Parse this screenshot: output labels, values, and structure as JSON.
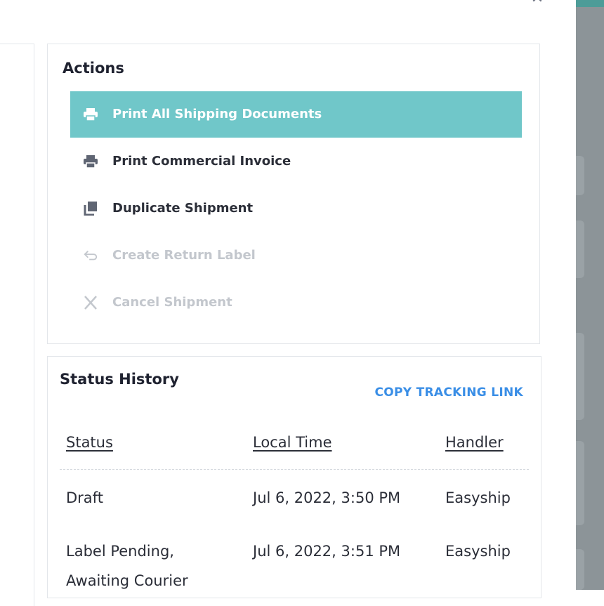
{
  "actions": {
    "title": "Actions",
    "items": [
      {
        "label": "Print All Shipping Documents",
        "icon": "printer-icon",
        "state": "highlighted"
      },
      {
        "label": "Print Commercial Invoice",
        "icon": "printer-icon",
        "state": "enabled"
      },
      {
        "label": "Duplicate Shipment",
        "icon": "duplicate-icon",
        "state": "enabled"
      },
      {
        "label": "Create Return Label",
        "icon": "return-arrow-icon",
        "state": "disabled"
      },
      {
        "label": "Cancel Shipment",
        "icon": "close-icon",
        "state": "disabled"
      }
    ]
  },
  "status_history": {
    "title": "Status History",
    "copy_link_label": "COPY TRACKING LINK",
    "columns": [
      "Status",
      "Local Time",
      "Handler"
    ],
    "rows": [
      {
        "status": "Draft",
        "status_line2": "",
        "time": "Jul 6, 2022, 3:50 PM",
        "handler": "Easyship"
      },
      {
        "status": "Label Pending,",
        "status_line2": "Awaiting Courier",
        "time": "Jul 6, 2022, 3:51 PM",
        "handler": "Easyship"
      }
    ]
  },
  "colors": {
    "accent": "#70c7c9",
    "link": "#3a8ee6",
    "disabled_text": "#c3c7cd",
    "text": "#2b2e38"
  }
}
